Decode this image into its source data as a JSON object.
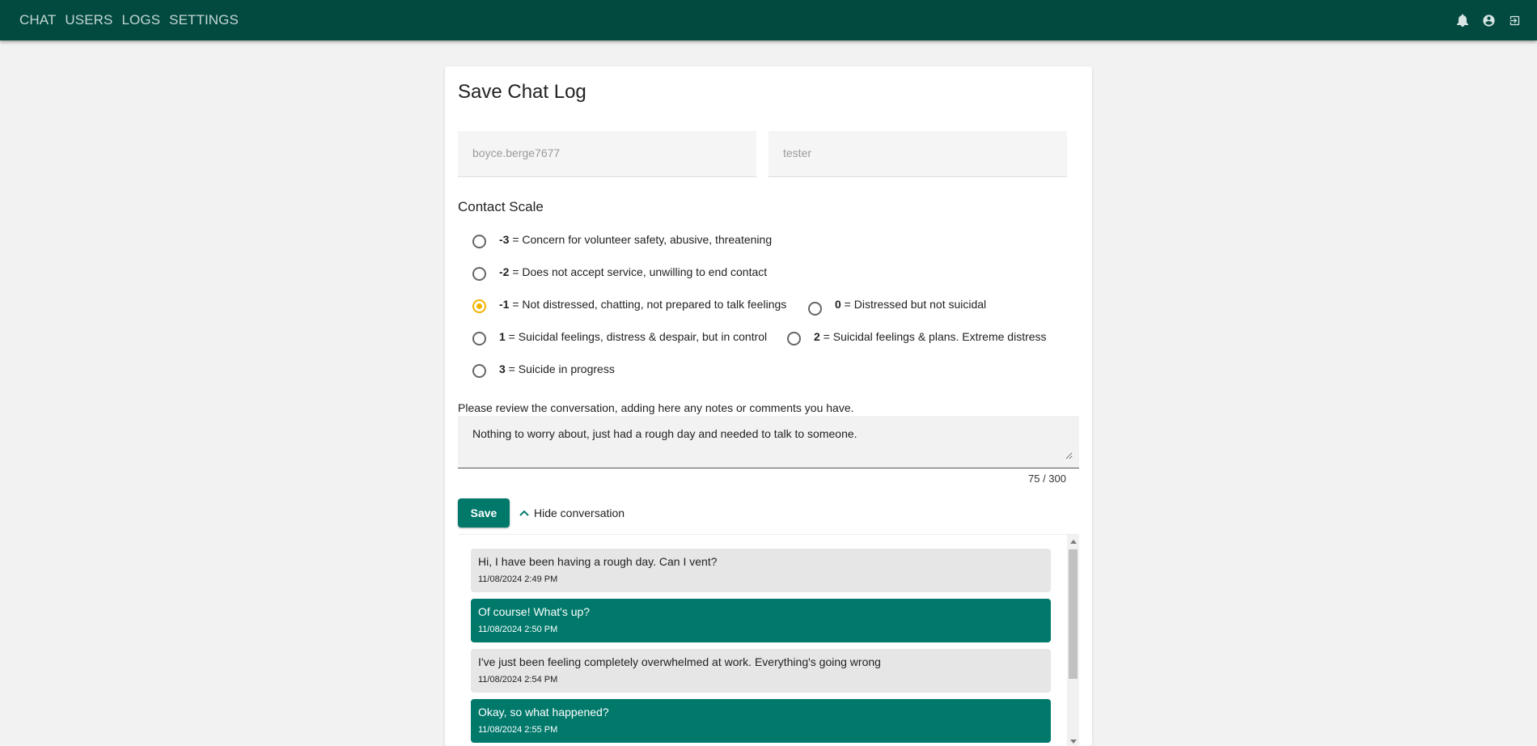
{
  "nav": {
    "items": [
      "CHAT",
      "USERS",
      "LOGS",
      "SETTINGS"
    ]
  },
  "header_icons": [
    "bell-icon",
    "account-circle-icon",
    "logout-icon"
  ],
  "card": {
    "title": "Save Chat Log",
    "username_value": "boyce.berge7677",
    "volunteer_value": "tester"
  },
  "contact_scale": {
    "title": "Contact Scale",
    "options": [
      {
        "value": "-3",
        "desc": " = Concern for volunteer safety, abusive, threatening",
        "checked": false
      },
      {
        "value": "-2",
        "desc": " = Does not accept service, unwilling to end contact",
        "checked": false
      },
      {
        "value": "-1",
        "desc": " = Not distressed, chatting, not prepared to talk feelings",
        "checked": true
      },
      {
        "value": "0",
        "desc": " = Distressed but not suicidal",
        "checked": false
      },
      {
        "value": "1",
        "desc": " = Suicidal feelings, distress & despair, but in control",
        "checked": false
      },
      {
        "value": "2",
        "desc": " = Suicidal feelings & plans. Extreme distress",
        "checked": false
      },
      {
        "value": "3",
        "desc": " = Suicide in progress",
        "checked": false
      }
    ],
    "selected_color": "#f4b400"
  },
  "notes": {
    "label": "Please review the conversation, adding here any notes or comments you have.",
    "value": "Nothing to worry about, just had a rough day and needed to talk to someone.",
    "counter": "75 / 300"
  },
  "actions": {
    "save_label": "Save",
    "hide_label": "Hide conversation"
  },
  "messages": [
    {
      "sender": "them",
      "text": "Hi, I have been having a rough day. Can I vent?",
      "time": "11/08/2024 2:49 PM"
    },
    {
      "sender": "me",
      "text": "Of course! What's up?",
      "time": "11/08/2024 2:50 PM"
    },
    {
      "sender": "them",
      "text": "I've just been feeling completely overwhelmed at work. Everything's going wrong",
      "time": "11/08/2024 2:54 PM"
    },
    {
      "sender": "me",
      "text": "Okay, so what happened?",
      "time": "11/08/2024 2:55 PM"
    }
  ],
  "colors": {
    "topbar": "#024a40",
    "primary": "#00796b",
    "background": "#f2f2f2"
  }
}
